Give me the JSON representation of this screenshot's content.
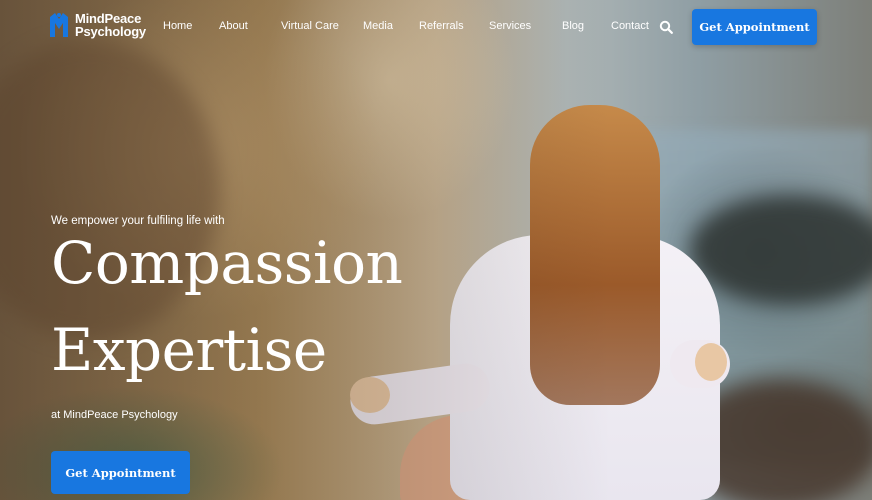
{
  "brand": {
    "name_line1": "MindPeace",
    "name_line2": "Psychology",
    "logo_color": "#1877e0"
  },
  "nav": {
    "items": [
      {
        "label": "Home"
      },
      {
        "label": "About"
      },
      {
        "label": "Virtual Care"
      },
      {
        "label": "Media"
      },
      {
        "label": "Referrals"
      },
      {
        "label": "Services"
      },
      {
        "label": "Blog"
      },
      {
        "label": "Contact"
      }
    ],
    "search_icon": "search-icon",
    "cta_label": "Get Appointment"
  },
  "hero": {
    "tagline": "We empower your fulfiling life with",
    "headline_line1": "Compassion",
    "headline_line2": "Expertise",
    "subtagline": "at MindPeace Psychology",
    "cta_label": "Get Appointment",
    "accent_color": "#1877e0"
  }
}
